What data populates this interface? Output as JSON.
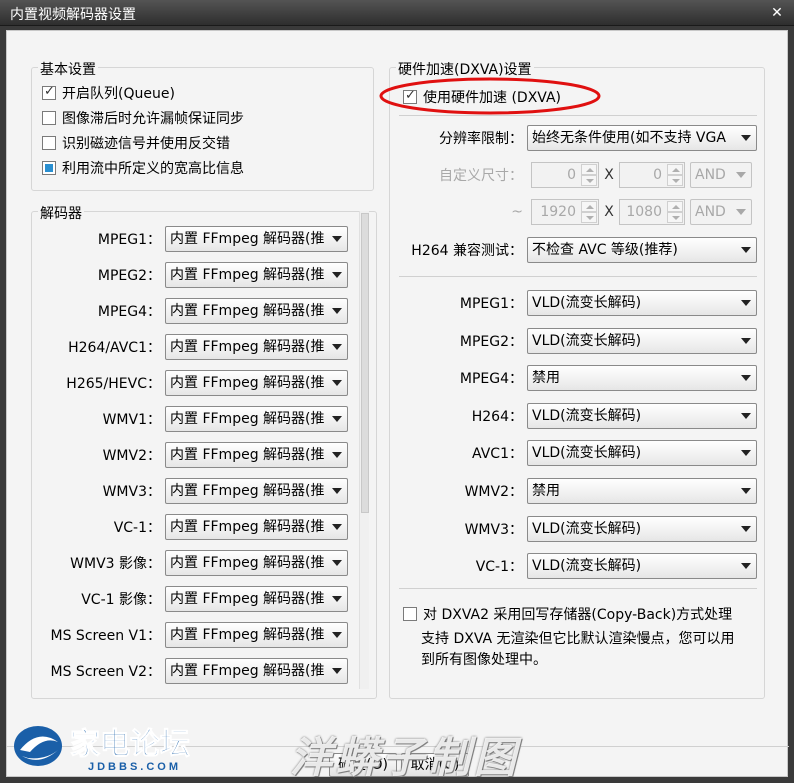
{
  "window": {
    "title": "内置视频解码器设置"
  },
  "basic": {
    "title": "基本设置",
    "options": [
      {
        "label": "开启队列(Queue)",
        "state": "checked"
      },
      {
        "label": "图像滞后时允许漏帧保证同步",
        "state": "unchecked"
      },
      {
        "label": "识别磁迹信号并使用反交错",
        "state": "unchecked"
      },
      {
        "label": "利用流中所定义的宽高比信息",
        "state": "filled"
      }
    ]
  },
  "decoders": {
    "title": "解码器",
    "rows": [
      {
        "label": "MPEG1：",
        "value": "内置 FFmpeg 解码器(推"
      },
      {
        "label": "MPEG2：",
        "value": "内置 FFmpeg 解码器(推"
      },
      {
        "label": "MPEG4：",
        "value": "内置 FFmpeg 解码器(推"
      },
      {
        "label": "H264/AVC1：",
        "value": "内置 FFmpeg 解码器(推"
      },
      {
        "label": "H265/HEVC：",
        "value": "内置 FFmpeg 解码器(推"
      },
      {
        "label": "WMV1：",
        "value": "内置 FFmpeg 解码器(推"
      },
      {
        "label": "WMV2：",
        "value": "内置 FFmpeg 解码器(推"
      },
      {
        "label": "WMV3：",
        "value": "内置 FFmpeg 解码器(推"
      },
      {
        "label": "VC-1：",
        "value": "内置 FFmpeg 解码器(推"
      },
      {
        "label": "WMV3 影像：",
        "value": "内置 FFmpeg 解码器(推"
      },
      {
        "label": "VC-1 影像：",
        "value": "内置 FFmpeg 解码器(推"
      },
      {
        "label": "MS Screen V1：",
        "value": "内置 FFmpeg 解码器(推"
      },
      {
        "label": "MS Screen V2：",
        "value": "内置 FFmpeg 解码器(推"
      }
    ]
  },
  "hw": {
    "title": "硬件加速(DXVA)设置",
    "enable_label": "使用硬件加速 (DXVA)",
    "resolution_label": "分辨率限制：",
    "resolution_value": "始终无条件使用(如不支持 VGA",
    "custom_size_label": "自定义尺寸：",
    "min_w": "0",
    "min_h": "0",
    "min_op": "AND",
    "tilde": "~",
    "max_w": "1920",
    "max_h": "1080",
    "max_op": "AND",
    "x_sep": "X",
    "h264_test_label": "H264 兼容测试：",
    "h264_test_value": "不检查 AVC 等级(推荐)",
    "codecs": [
      {
        "label": "MPEG1：",
        "value": "VLD(流变长解码)"
      },
      {
        "label": "MPEG2：",
        "value": "VLD(流变长解码)"
      },
      {
        "label": "MPEG4：",
        "value": "禁用"
      },
      {
        "label": "H264：",
        "value": "VLD(流变长解码)"
      },
      {
        "label": "AVC1：",
        "value": "VLD(流变长解码)"
      },
      {
        "label": "WMV2：",
        "value": "禁用"
      },
      {
        "label": "WMV3：",
        "value": "VLD(流变长解码)"
      },
      {
        "label": "VC-1：",
        "value": "VLD(流变长解码)"
      }
    ],
    "copyback_label": "对 DXVA2 采用回写存储器(Copy-Back)方式处理",
    "note_line1": "支持 DXVA 无渲染但它比默认渲染慢点，您可以用",
    "note_line2": "到所有图像处理中。"
  },
  "footer": {
    "ok_label": "确定(O)",
    "cancel_label": "取消(C)"
  },
  "branding": {
    "logo_text": "家电论坛",
    "logo_sub": "JDBBS.COM",
    "watermark": "洋蟒子制图"
  },
  "colors": {
    "annotation": "#e01010",
    "accent": "#2a8fd0"
  }
}
